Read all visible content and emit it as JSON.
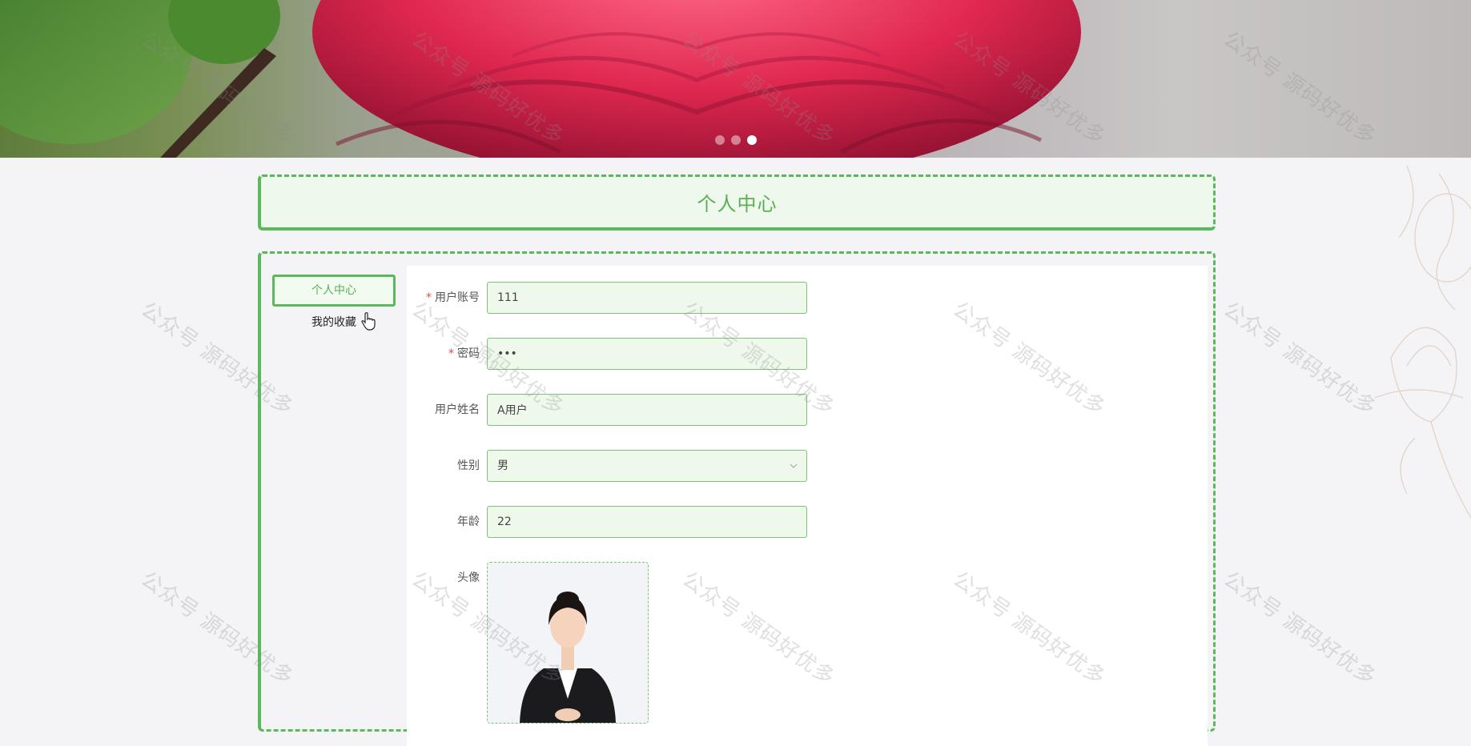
{
  "banner": {
    "slides": 3,
    "active_slide": 3
  },
  "page_title": "个人中心",
  "menu": {
    "items": [
      {
        "label": "个人中心",
        "active": true
      },
      {
        "label": "我的收藏",
        "active": false
      }
    ]
  },
  "form": {
    "account": {
      "label": "用户账号",
      "required": true,
      "value": "111"
    },
    "password": {
      "label": "密码",
      "required": true,
      "value": "•••"
    },
    "name": {
      "label": "用户姓名",
      "required": false,
      "value": "A用户"
    },
    "gender": {
      "label": "性别",
      "required": false,
      "value": "男"
    },
    "age": {
      "label": "年龄",
      "required": false,
      "value": "22"
    },
    "avatar": {
      "label": "头像",
      "required": false
    }
  },
  "watermark": "公众号 源码好优多",
  "colors": {
    "accent": "#5cb85c",
    "field_bg": "#eef9ec",
    "title_text": "#5cae55"
  }
}
